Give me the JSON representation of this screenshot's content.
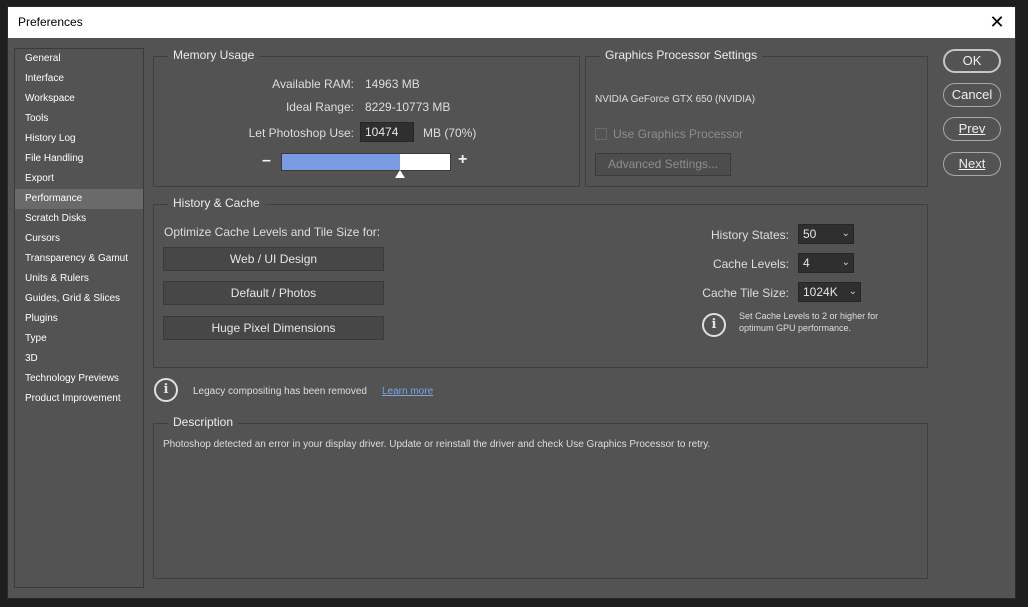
{
  "window": {
    "title": "Preferences"
  },
  "sidebar": {
    "items": [
      {
        "label": "General"
      },
      {
        "label": "Interface"
      },
      {
        "label": "Workspace"
      },
      {
        "label": "Tools"
      },
      {
        "label": "History Log"
      },
      {
        "label": "File Handling"
      },
      {
        "label": "Export"
      },
      {
        "label": "Performance",
        "selected": true
      },
      {
        "label": "Scratch Disks"
      },
      {
        "label": "Cursors"
      },
      {
        "label": "Transparency & Gamut"
      },
      {
        "label": "Units & Rulers"
      },
      {
        "label": "Guides, Grid & Slices"
      },
      {
        "label": "Plugins"
      },
      {
        "label": "Type"
      },
      {
        "label": "3D"
      },
      {
        "label": "Technology Previews"
      },
      {
        "label": "Product Improvement"
      }
    ]
  },
  "memory": {
    "title": "Memory Usage",
    "available_label": "Available RAM:",
    "available_value": "14963 MB",
    "ideal_label": "Ideal Range:",
    "ideal_value": "8229-10773 MB",
    "use_label": "Let Photoshop Use:",
    "use_value": "10474",
    "use_unit": "MB (70%)",
    "slider_fraction": 0.7,
    "minus": "–",
    "plus": "+"
  },
  "gpu": {
    "title": "Graphics Processor Settings",
    "device": "NVIDIA GeForce GTX 650 (NVIDIA)",
    "use_gpu_label": "Use Graphics Processor",
    "use_gpu_checked": false,
    "advanced_label": "Advanced Settings..."
  },
  "history": {
    "title": "History & Cache",
    "optimize_label": "Optimize Cache Levels and Tile Size for:",
    "presets": [
      "Web / UI Design",
      "Default / Photos",
      "Huge Pixel Dimensions"
    ],
    "states_label": "History States:",
    "states_value": "50",
    "levels_label": "Cache Levels:",
    "levels_value": "4",
    "tile_label": "Cache Tile Size:",
    "tile_value": "1024K",
    "tip_line1": "Set Cache Levels to 2 or higher for",
    "tip_line2": "optimum GPU performance."
  },
  "notice": {
    "text": "Legacy compositing has been removed",
    "link": "Learn more"
  },
  "description": {
    "title": "Description",
    "text": "Photoshop detected an error in your display driver. Update or reinstall the driver and check Use Graphics Processor to retry."
  },
  "buttons": {
    "ok": "OK",
    "cancel": "Cancel",
    "prev": "Prev",
    "next": "Next"
  },
  "colors": {
    "dialog_bg": "#535353",
    "slider_fill": "#7b9be3",
    "link": "#7da4e0"
  }
}
